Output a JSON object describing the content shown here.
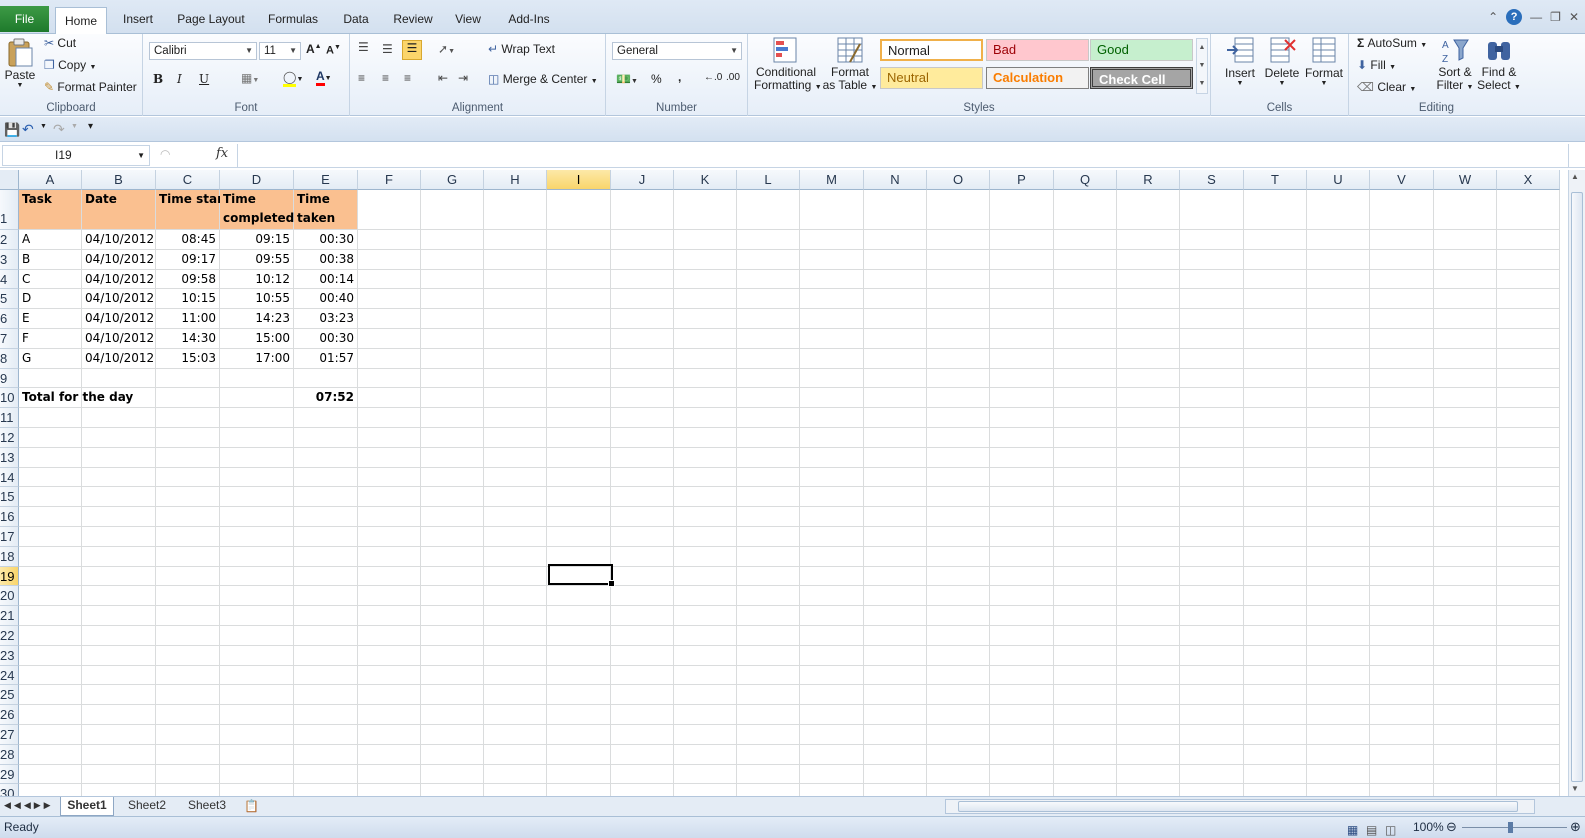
{
  "ribbon_tabs": [
    "File",
    "Home",
    "Insert",
    "Page Layout",
    "Formulas",
    "Data",
    "Review",
    "View",
    "Add-Ins"
  ],
  "clipboard": {
    "paste": "Paste",
    "cut": "Cut",
    "copy": "Copy",
    "format_painter": "Format Painter",
    "label": "Clipboard"
  },
  "font": {
    "name": "Calibri",
    "size": "11",
    "label": "Font",
    "bold": "B",
    "italic": "I",
    "underline": "U"
  },
  "alignment": {
    "wrap": "Wrap Text",
    "merge": "Merge & Center",
    "label": "Alignment"
  },
  "number": {
    "format": "General",
    "percent": "%",
    "comma": ",",
    "label": "Number"
  },
  "styles": {
    "conditional1": "Conditional",
    "conditional2": "Formatting",
    "format_table1": "Format",
    "format_table2": "as Table",
    "normal": "Normal",
    "bad": "Bad",
    "good": "Good",
    "neutral": "Neutral",
    "calculation": "Calculation",
    "check_cell": "Check Cell",
    "label": "Styles"
  },
  "cells": {
    "insert": "Insert",
    "delete": "Delete",
    "format": "Format",
    "label": "Cells"
  },
  "editing": {
    "autosum": "AutoSum",
    "fill": "Fill",
    "clear": "Clear",
    "sort1": "Sort &",
    "sort2": "Filter",
    "find1": "Find &",
    "find2": "Select",
    "label": "Editing"
  },
  "name_box": "I19",
  "fx": "fx",
  "columns": [
    "A",
    "B",
    "C",
    "D",
    "E",
    "F",
    "G",
    "H",
    "I",
    "J",
    "K",
    "L",
    "M",
    "N",
    "O",
    "P",
    "Q",
    "R",
    "S",
    "T",
    "U",
    "V",
    "W",
    "X"
  ],
  "rows": [
    "1",
    "2",
    "3",
    "4",
    "5",
    "6",
    "7",
    "8",
    "9",
    "10",
    "11",
    "12",
    "13",
    "14",
    "15",
    "16",
    "17",
    "18",
    "19",
    "20",
    "21",
    "22",
    "23",
    "24",
    "25",
    "26",
    "27",
    "28",
    "29",
    "30"
  ],
  "header": {
    "task": "Task",
    "date": "Date",
    "start": "Time start",
    "completed1": "Time",
    "completed2": "completed",
    "taken1": "Time",
    "taken2": "taken"
  },
  "data": [
    [
      "A",
      "04/10/2012",
      "08:45",
      "09:15",
      "00:30"
    ],
    [
      "B",
      "04/10/2012",
      "09:17",
      "09:55",
      "00:38"
    ],
    [
      "C",
      "04/10/2012",
      "09:58",
      "10:12",
      "00:14"
    ],
    [
      "D",
      "04/10/2012",
      "10:15",
      "10:55",
      "00:40"
    ],
    [
      "E",
      "04/10/2012",
      "11:00",
      "14:23",
      "03:23"
    ],
    [
      "F",
      "04/10/2012",
      "14:30",
      "15:00",
      "00:30"
    ],
    [
      "G",
      "04/10/2012",
      "15:03",
      "17:00",
      "01:57"
    ]
  ],
  "total": {
    "label": "Total for the day",
    "value": "07:52"
  },
  "sheets": [
    "Sheet1",
    "Sheet2",
    "Sheet3"
  ],
  "status": {
    "text": "Ready",
    "zoom": "100%"
  },
  "colors": {
    "header_fill": "#fac090",
    "file_tab": "#1e7a2c",
    "selection": "#000000"
  }
}
